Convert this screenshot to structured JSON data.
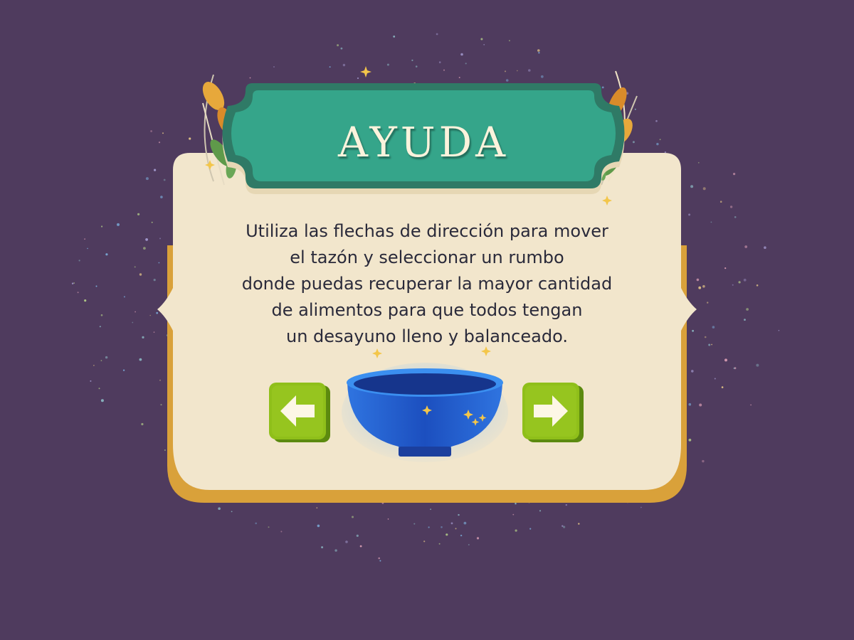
{
  "dialog": {
    "title": "AYUDA",
    "instructions": [
      "Utiliza las flechas de dirección para mover",
      "el tazón y seleccionar un rumbo",
      "donde puedas recuperar la mayor cantidad",
      "de alimentos para que todos tengan",
      "un desayuno lleno y balanceado."
    ]
  },
  "controls": {
    "left_icon": "arrow-left-icon",
    "right_icon": "arrow-right-icon",
    "bowl_icon": "bowl-icon"
  },
  "colors": {
    "background": "#4f3b5e",
    "panel": "#f2e6cc",
    "panel_edge": "#d9a13a",
    "title_banner": "#2f9c83",
    "arrow_button": "#8fbf1a",
    "bowl": "#1f5fd1"
  }
}
